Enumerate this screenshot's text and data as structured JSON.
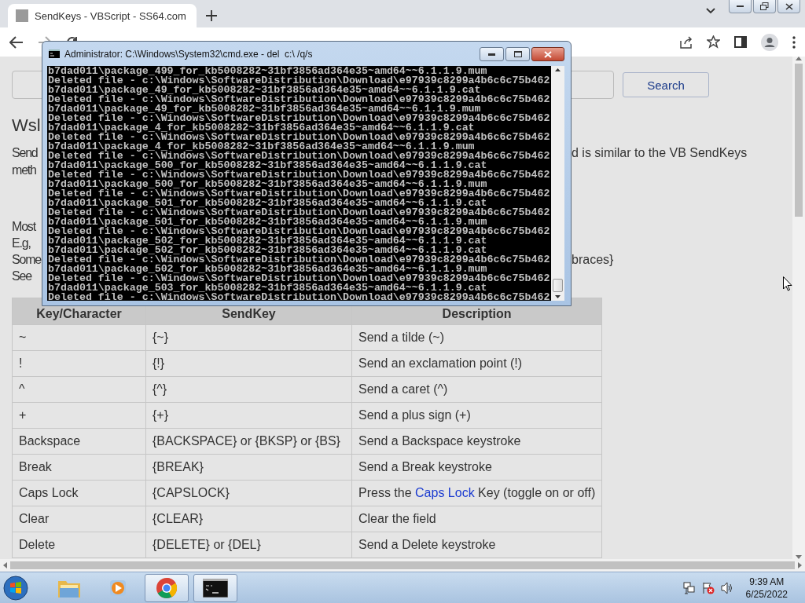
{
  "browser": {
    "tab": {
      "title": "SendKeys - VBScript - SS64.com",
      "selected": true
    }
  },
  "page": {
    "search_button": "Search",
    "heading": "Wsl",
    "intro": [
      {
        "left": "Send",
        "right": "d is similar to the VB SendKeys"
      },
      {
        "left": "meth"
      }
    ],
    "notes": [
      {
        "left": "Most"
      },
      {
        "left": "E.g,"
      },
      {
        "left": "Some",
        "right": "braces}"
      },
      {
        "left": "See"
      }
    ]
  },
  "table": {
    "columns": [
      "Key/Character",
      "SendKey",
      "Description"
    ],
    "rows": [
      {
        "key": "~",
        "sendkey": "{~}",
        "description": {
          "text": "Send a tilde (~)"
        }
      },
      {
        "key": "!",
        "sendkey": "{!}",
        "description": {
          "text": "Send an exclamation point (!)"
        }
      },
      {
        "key": "^",
        "sendkey": "{^}",
        "description": {
          "text": "Send a caret (^)"
        }
      },
      {
        "key": "+",
        "sendkey": "{+}",
        "description": {
          "text": "Send a plus sign (+)"
        }
      },
      {
        "key": "Backspace",
        "sendkey": "{BACKSPACE} or {BKSP} or {BS}",
        "description": {
          "text": "Send a Backspace keystroke"
        }
      },
      {
        "key": "Break",
        "sendkey": "{BREAK}",
        "description": {
          "text": "Send a Break keystroke"
        }
      },
      {
        "key": "Caps Lock",
        "sendkey": "{CAPSLOCK}",
        "description": {
          "text": "Press the",
          "link": "Caps Lock",
          "after": "Key (toggle on or off)"
        }
      },
      {
        "key": "Clear",
        "sendkey": "{CLEAR}",
        "description": {
          "text": "Clear the field"
        }
      },
      {
        "key": "Delete",
        "sendkey": "{DELETE} or {DEL}",
        "description": {
          "text": "Send a Delete keystroke"
        }
      }
    ]
  },
  "console_window": {
    "title": "Administrator: C:\\Windows\\System32\\cmd.exe - del  c:\\ /q/s",
    "lines": [
      "b7dad011\\package_499_for_kb5008282~31bf3856ad364e35~amd64~~6.1.1.9.mum",
      "Deleted file - c:\\Windows\\SoftwareDistribution\\Download\\e97939c8299a4b6c6c75b462",
      "b7dad011\\package_49_for_kb5008282~31bf3856ad364e35~amd64~~6.1.1.9.cat",
      "Deleted file - c:\\Windows\\SoftwareDistribution\\Download\\e97939c8299a4b6c6c75b462",
      "b7dad011\\package_49_for_kb5008282~31bf3856ad364e35~amd64~~6.1.1.9.mum",
      "Deleted file - c:\\Windows\\SoftwareDistribution\\Download\\e97939c8299a4b6c6c75b462",
      "b7dad011\\package_4_for_kb5008282~31bf3856ad364e35~amd64~~6.1.1.9.cat",
      "Deleted file - c:\\Windows\\SoftwareDistribution\\Download\\e97939c8299a4b6c6c75b462",
      "b7dad011\\package_4_for_kb5008282~31bf3856ad364e35~amd64~~6.1.1.9.mum",
      "Deleted file - c:\\Windows\\SoftwareDistribution\\Download\\e97939c8299a4b6c6c75b462",
      "b7dad011\\package_500_for_kb5008282~31bf3856ad364e35~amd64~~6.1.1.9.cat",
      "Deleted file - c:\\Windows\\SoftwareDistribution\\Download\\e97939c8299a4b6c6c75b462",
      "b7dad011\\package_500_for_kb5008282~31bf3856ad364e35~amd64~~6.1.1.9.mum",
      "Deleted file - c:\\Windows\\SoftwareDistribution\\Download\\e97939c8299a4b6c6c75b462",
      "b7dad011\\package_501_for_kb5008282~31bf3856ad364e35~amd64~~6.1.1.9.cat",
      "Deleted file - c:\\Windows\\SoftwareDistribution\\Download\\e97939c8299a4b6c6c75b462",
      "b7dad011\\package_501_for_kb5008282~31bf3856ad364e35~amd64~~6.1.1.9.mum",
      "Deleted file - c:\\Windows\\SoftwareDistribution\\Download\\e97939c8299a4b6c6c75b462",
      "b7dad011\\package_502_for_kb5008282~31bf3856ad364e35~amd64~~6.1.1.9.cat",
      "b7dad011\\package_502_for_kb5008282~31bf3856ad364e35~amd64~~6.1.1.9.cat",
      "Deleted file - c:\\Windows\\SoftwareDistribution\\Download\\e97939c8299a4b6c6c75b462",
      "b7dad011\\package_502_for_kb5008282~31bf3856ad364e35~amd64~~6.1.1.9.mum",
      "Deleted file - c:\\Windows\\SoftwareDistribution\\Download\\e97939c8299a4b6c6c75b462",
      "b7dad011\\package_503_for_kb5008282~31bf3856ad364e35~amd64~~6.1.1.9.cat",
      "Deleted file - c:\\Windows\\SoftwareDistribution\\Download\\e97939c8299a4b6c6c75b462"
    ]
  },
  "taskbar": {
    "apps": [
      {
        "kind": "folder",
        "selected": false
      },
      {
        "kind": "media",
        "selected": false
      },
      {
        "kind": "browser",
        "selected": true
      },
      {
        "kind": "terminal",
        "selected": true
      }
    ],
    "clock": {
      "time": "9:39 AM",
      "date": "6/25/2022"
    }
  }
}
